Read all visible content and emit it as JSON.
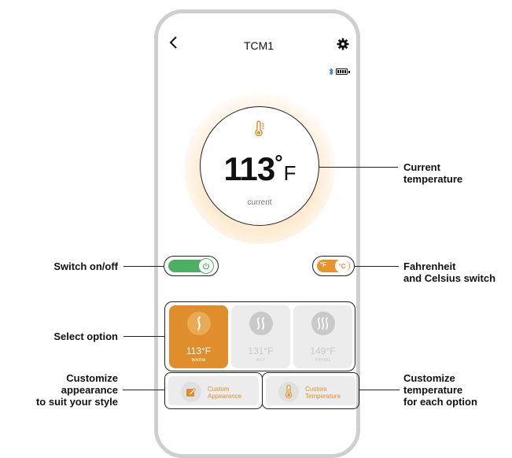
{
  "header": {
    "title": "TCM1"
  },
  "temperature": {
    "value": "113",
    "degree": "°",
    "unit": "F",
    "label": "current"
  },
  "unit_toggle": {
    "f_label": "°F",
    "c_label": "°C"
  },
  "options": [
    {
      "value": "113°F",
      "label": "WARM",
      "active": true
    },
    {
      "value": "131°F",
      "label": "HOT",
      "active": false
    },
    {
      "value": "149°F",
      "label": "PIPING",
      "active": false
    }
  ],
  "custom_buttons": {
    "appearance": {
      "line1": "Custom",
      "line2": "Appearance"
    },
    "temperature": {
      "line1": "Custom",
      "line2": "Temperature"
    }
  },
  "callouts": {
    "current_temperature": [
      "Current",
      "temperature"
    ],
    "switch": "Switch on/off",
    "fahrenheit_celsius": [
      "Fahrenheit",
      "and Celsius switch"
    ],
    "select_option": "Select option",
    "customize_appearance": [
      "Customize",
      "appearance",
      "to suit your style"
    ],
    "customize_temperature": [
      "Customize",
      "temperature",
      "for each option"
    ]
  },
  "colors": {
    "accent": "#e08e2c",
    "switch_on": "#4caf63",
    "inactive": "#ececec"
  }
}
